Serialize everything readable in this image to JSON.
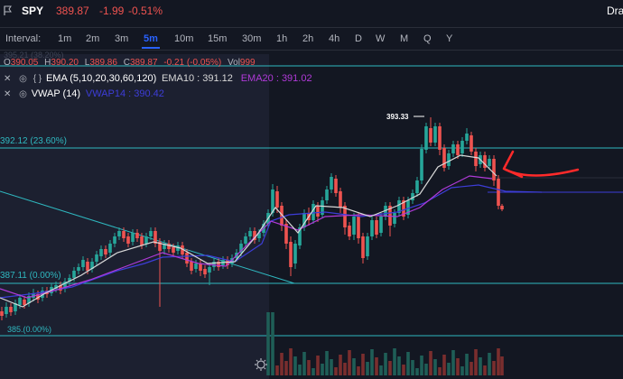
{
  "header": {
    "symbol": "SPY",
    "price": "389.87",
    "change": "-1.99",
    "change_pct": "-0.51%",
    "draw_label": "Dra"
  },
  "interval_bar": {
    "label": "Interval:",
    "items": [
      "1m",
      "2m",
      "3m",
      "5m",
      "10m",
      "15m",
      "30m",
      "1h",
      "2h",
      "4h",
      "D",
      "W",
      "M",
      "Q",
      "Y"
    ],
    "active": "5m"
  },
  "ohlc_legend": {
    "faded_top": "395.21 (38.20%)",
    "o_label": "O",
    "o_value": "390.05",
    "h_label": "H",
    "h_value": "390.20",
    "l_label": "L",
    "l_value": "389.86",
    "c_label": "C",
    "c_value": "389.87",
    "change": "-0.21 (-0.05%)",
    "vol_label": "Vol",
    "vol_value": "999"
  },
  "indicators": [
    {
      "name": "EMA (5,10,20,30,60,120)",
      "v1": "EMA10 : 391.12",
      "v2": "EMA20 : 391.02"
    },
    {
      "name": "VWAP (14)",
      "v1": "VWAP14 : 390.42"
    }
  ],
  "fib_labels": {
    "level_23": "392.12 (23.60%)",
    "level_0": "387.11 (0.00%)",
    "level_bottom": "385.(0.00%)"
  },
  "high_marker": "393.33",
  "colors": {
    "background": "#131722",
    "bull": "#26a69a",
    "bear": "#ef5350",
    "ema_white": "#d8d8d8",
    "ema_purple": "#b03ad8",
    "vwap_blue": "#3d3dd8",
    "fib_line": "#2fb8c0",
    "annotation": "#ff2a2a",
    "interval_active": "#2962ff"
  }
}
